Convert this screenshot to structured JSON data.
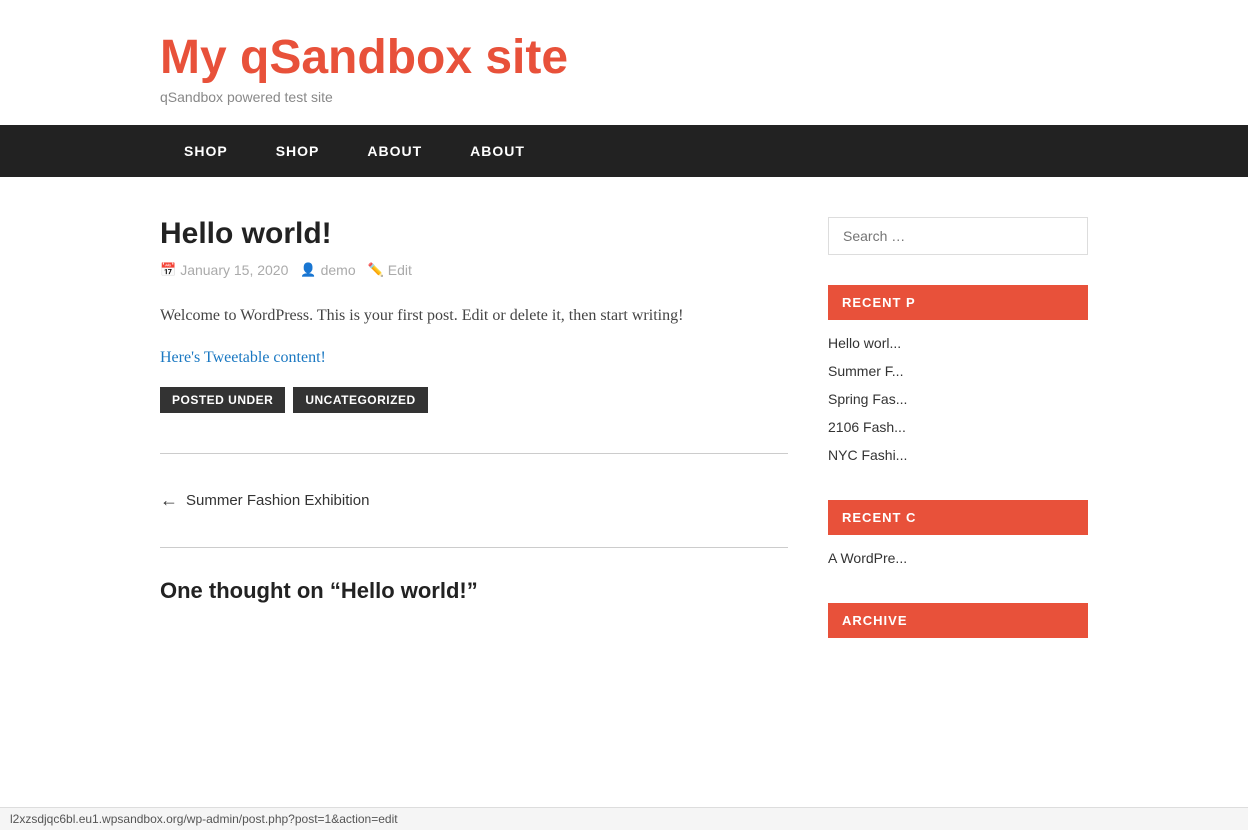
{
  "site": {
    "title": "My qSandbox site",
    "tagline": "qSandbox powered test site"
  },
  "nav": {
    "items": [
      {
        "label": "SHOP",
        "href": "#"
      },
      {
        "label": "SHOP",
        "href": "#"
      },
      {
        "label": "ABOUT",
        "href": "#"
      },
      {
        "label": "ABOUT",
        "href": "#"
      }
    ]
  },
  "post": {
    "title": "Hello world!",
    "date": "January 15, 2020",
    "author": "demo",
    "edit_label": "Edit",
    "body": "Welcome to WordPress. This is your first post. Edit or delete it, then start writing!",
    "tweetable_text": "Here's Tweetable content!",
    "tag_label": "POSTED UNDER",
    "category": "UNCATEGORIZED"
  },
  "post_nav": {
    "prev_label": "Summer Fashion Exhibition"
  },
  "comments": {
    "title": "One thought on “Hello world!”"
  },
  "sidebar": {
    "search_placeholder": "Search …",
    "recent_posts_title": "RECENT P",
    "recent_posts": [
      {
        "label": "Hello worl..."
      },
      {
        "label": "Summer F..."
      },
      {
        "label": "Spring Fas..."
      },
      {
        "label": "2106 Fash..."
      },
      {
        "label": "NYC Fashi..."
      }
    ],
    "recent_comments_title": "RECENT C",
    "recent_comments": [
      {
        "label": "A WordPre..."
      }
    ],
    "archives_title": "ARCHIVE"
  },
  "status_bar": {
    "url": "l2xzsdjqc6bl.eu1.wpsandbox.org/wp-admin/post.php?post=1&action=edit"
  }
}
